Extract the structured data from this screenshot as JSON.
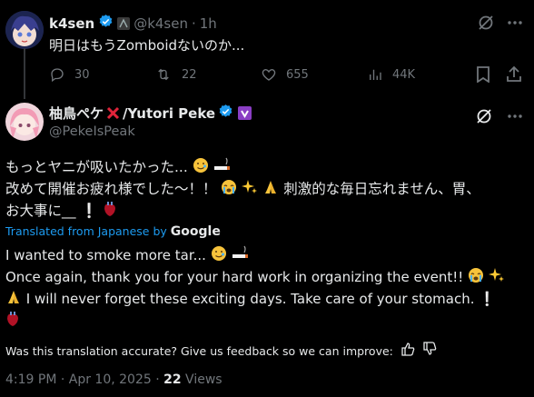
{
  "reply": {
    "display_name": "k4sen",
    "handle": "@k4sen",
    "separator": "·",
    "time": "1h",
    "text": "明日はもうZomboidないのか...",
    "metrics": {
      "replies": "30",
      "reposts": "22",
      "likes": "655",
      "views": "44K"
    }
  },
  "main": {
    "display_name_jp": "柚鳥ペケ",
    "display_name_en": "/Yutori Peke",
    "handle": "@PekeIsPeak",
    "text_line1": "もっとヤニが吸いたかった...",
    "text_line2": "改めて開催お疲れ様でした〜！！",
    "text_line2b": "刺激的な毎日忘れません、胃、",
    "text_line3": "お大事に__",
    "translated_from": "Translated from Japanese by",
    "translator": "Google",
    "en_line1": "I wanted to smoke more tar...",
    "en_line2": "Once again, thank you for your hard work in organizing the event!!",
    "en_line3": "I will never forget these exciting days. Take care of your stomach.",
    "feedback": "Was this translation accurate? Give us feedback so we can improve:",
    "timestamp": "4:19 PM · Apr 10, 2025 · ",
    "views_count": "22",
    "views_label": " Views"
  },
  "colors": {
    "background": "#000000",
    "text": "#e7e9ea",
    "muted": "#71767b",
    "accent": "#1d9bf0",
    "verified": "#1d9bf0",
    "purple_badge": "#7856ff"
  }
}
